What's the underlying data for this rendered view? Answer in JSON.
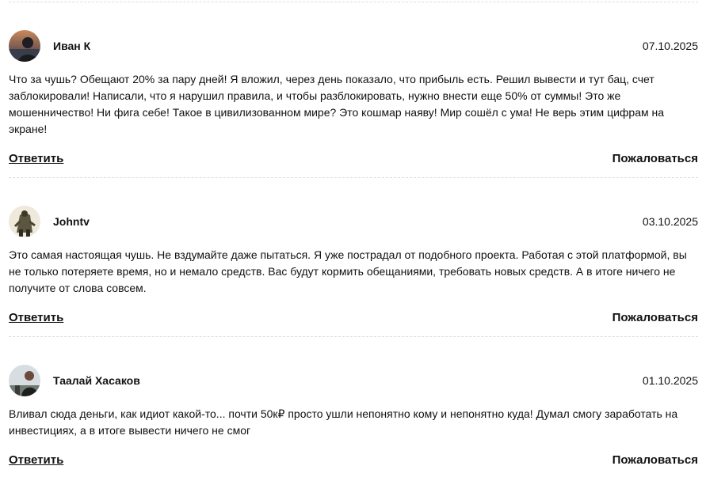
{
  "comments": [
    {
      "author": "Иван К",
      "date": "07.10.2025",
      "text": "Что за чушь? Обещают 20% за пару дней! Я вложил, через день показало, что прибыль есть. Решил вывести и тут бац, счет заблокировали! Написали, что я нарушил правила, и чтобы разблокировать, нужно внести еще 50% от суммы! Это же мошенничество! Ни фига себе! Такое в цивилизованном мире? Это кошмар наяву! Мир сошёл с ума! Не верь этим цифрам на экране!",
      "reply_label": "Ответить",
      "report_label": "Пожаловаться"
    },
    {
      "author": "Johntv",
      "date": "03.10.2025",
      "text": "Это самая настоящая чушь. Не вздумайте даже пытаться. Я уже пострадал от подобного проекта. Работая с этой платформой, вы не только потеряете время, но и немало средств. Вас будут кормить обещаниями, требовать новых средств. А в итоге ничего не получите от слова совсем.",
      "reply_label": "Ответить",
      "report_label": "Пожаловаться"
    },
    {
      "author": "Таалай Хасаков",
      "date": "01.10.2025",
      "text": "Вливал сюда деньги, как идиот какой-то... почти 50к₽ просто ушли непонятно кому и непонятно куда! Думал смогу заработать на инвестициях, а в итоге вывести ничего не смог",
      "reply_label": "Ответить",
      "report_label": "Пожаловаться"
    }
  ]
}
